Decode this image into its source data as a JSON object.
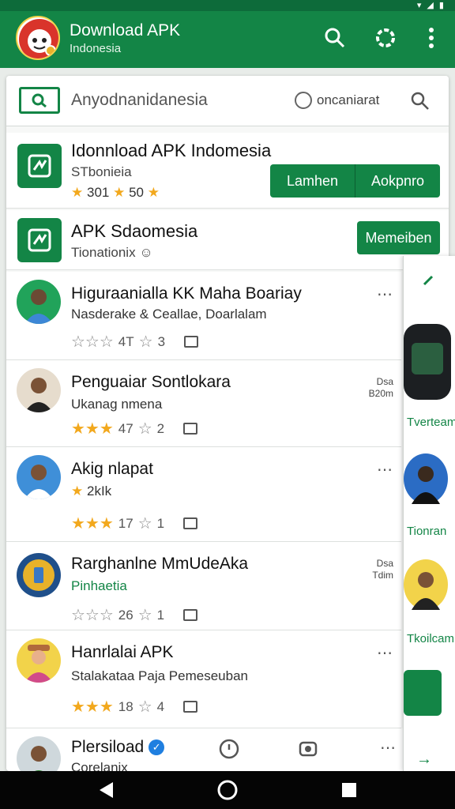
{
  "appbar": {
    "title": "Download APK",
    "subtitle": "Indonesia",
    "color": "#138546"
  },
  "search": {
    "query": "Anyodnanidanesia",
    "option_label": "oncaniarat"
  },
  "featured": [
    {
      "title": "Idonnload APK Indomesia",
      "subtitle": "STbonieia",
      "rating_a": "301",
      "rating_b": "50",
      "button_left": "Lamhen",
      "button_right": "Aokpnro"
    },
    {
      "title": "APK Sdaomesia",
      "subtitle": "Tionationix",
      "button": "Memeiben"
    }
  ],
  "list": [
    {
      "title": "Higuraanialla KK Maha Boariay",
      "subtitle": "Nasderake & Ceallae, Doarlalam",
      "star_count": "4T",
      "star_score": "3",
      "stars_filled": 0
    },
    {
      "title": "Penguaiar Sontlokara",
      "subtitle": "Ukanag nmena",
      "star_count": "47",
      "star_score": "2",
      "meta_top": "Dsa",
      "meta_bottom": "B20m",
      "stars_filled": 3
    },
    {
      "title": "Akig nlapat",
      "subtitle": "2kIk",
      "star_count": "17",
      "star_score": "1",
      "stars_filled": 3
    },
    {
      "title": "Rarghanlne MmUdeAka",
      "subtitle": "Pinhaetia",
      "star_count": "26",
      "star_score": "1",
      "meta_top": "Dsa",
      "meta_bottom": "Tdim",
      "stars_filled": 0
    },
    {
      "title": "Hanrlalai APK",
      "subtitle": "Stalakataa Paja Pemeseuban",
      "star_count": "18",
      "star_score": "4",
      "stars_filled": 3
    }
  ],
  "bottom_item": {
    "title": "Plersiload",
    "subtitle": "Corelanix"
  },
  "peek": {
    "labels": [
      "Tverteam",
      "Tionran",
      "Tkoilcam"
    ]
  }
}
